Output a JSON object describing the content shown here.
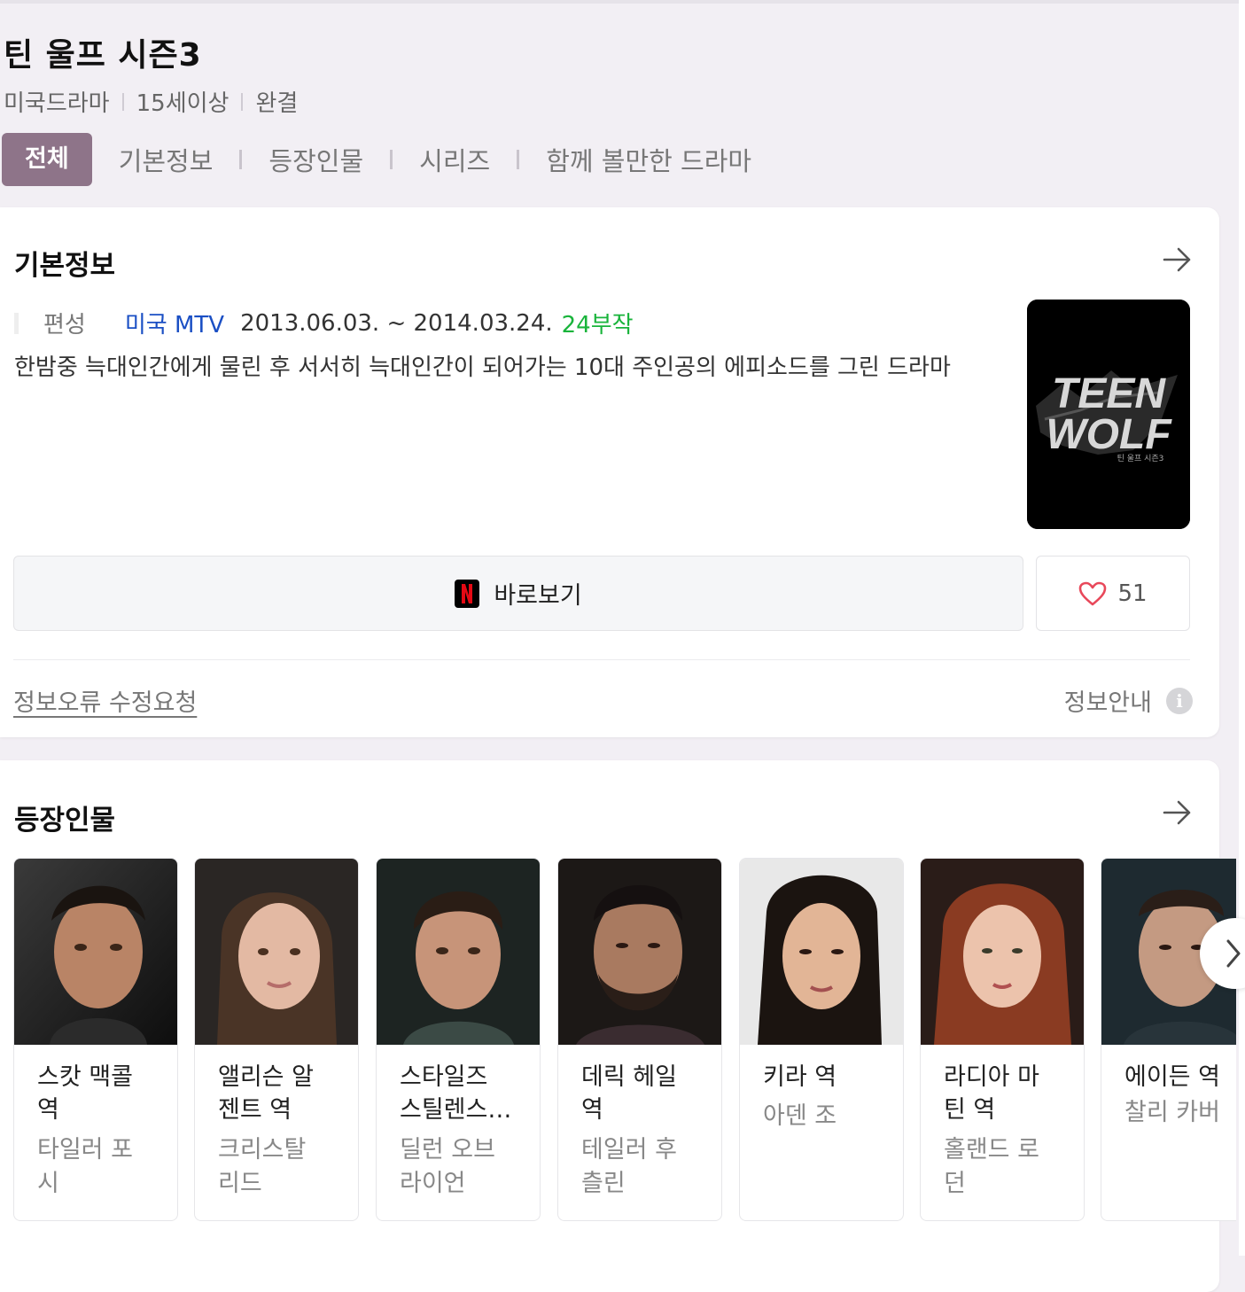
{
  "header": {
    "title": "틴 울프 시즌3",
    "meta": [
      "미국드라마",
      "15세이상",
      "완결"
    ]
  },
  "tabs": [
    "전체",
    "기본정보",
    "등장인물",
    "시리즈",
    "함께 볼만한 드라마"
  ],
  "basic_info": {
    "section_title": "기본정보",
    "label": "편성",
    "network": "미국 MTV",
    "dates": "2013.06.03. ~ 2014.03.24.",
    "episodes": "24부작",
    "synopsis": "한밤중 늑대인간에게 물린 후 서서히 늑대인간이 되어가는 10대 주인공의 에피소드를 그린 드라마",
    "poster_title_line1": "TEEN",
    "poster_title_line2": "WOLF",
    "poster_subtitle": "틴 울프 시즌3",
    "watch_label": "바로보기",
    "like_count": "51",
    "report_link": "정보오류 수정요청",
    "info_guide": "정보안내"
  },
  "cast": {
    "section_title": "등장인물",
    "members": [
      {
        "role_line1": "스캇 맥콜",
        "role_line2": "역",
        "actor_line1": "타일러 포",
        "actor_line2": "시"
      },
      {
        "role_line1": "앨리슨 알",
        "role_line2": "젠트 역",
        "actor_line1": "크리스탈",
        "actor_line2": "리드"
      },
      {
        "role_line1": "스타일즈",
        "role_line2": "스틸렌스…",
        "actor_line1": "딜런 오브",
        "actor_line2": "라이언"
      },
      {
        "role_line1": "데릭 헤일",
        "role_line2": "역",
        "actor_line1": "테일러 후",
        "actor_line2": "츨린"
      },
      {
        "role_line1": "키라 역",
        "role_line2": "",
        "actor_line1": "아덴 조",
        "actor_line2": ""
      },
      {
        "role_line1": "라디아 마",
        "role_line2": "틴 역",
        "actor_line1": "홀랜드 로",
        "actor_line2": "던"
      },
      {
        "role_line1": "에이든 역",
        "role_line2": "",
        "actor_line1": "찰리 카버",
        "actor_line2": ""
      }
    ]
  },
  "colors": {
    "accent_tab": "#8e7489",
    "network": "#1a4fc4",
    "episodes": "#19b43b",
    "heart": "#e8485a",
    "netflix": "#e50914"
  }
}
